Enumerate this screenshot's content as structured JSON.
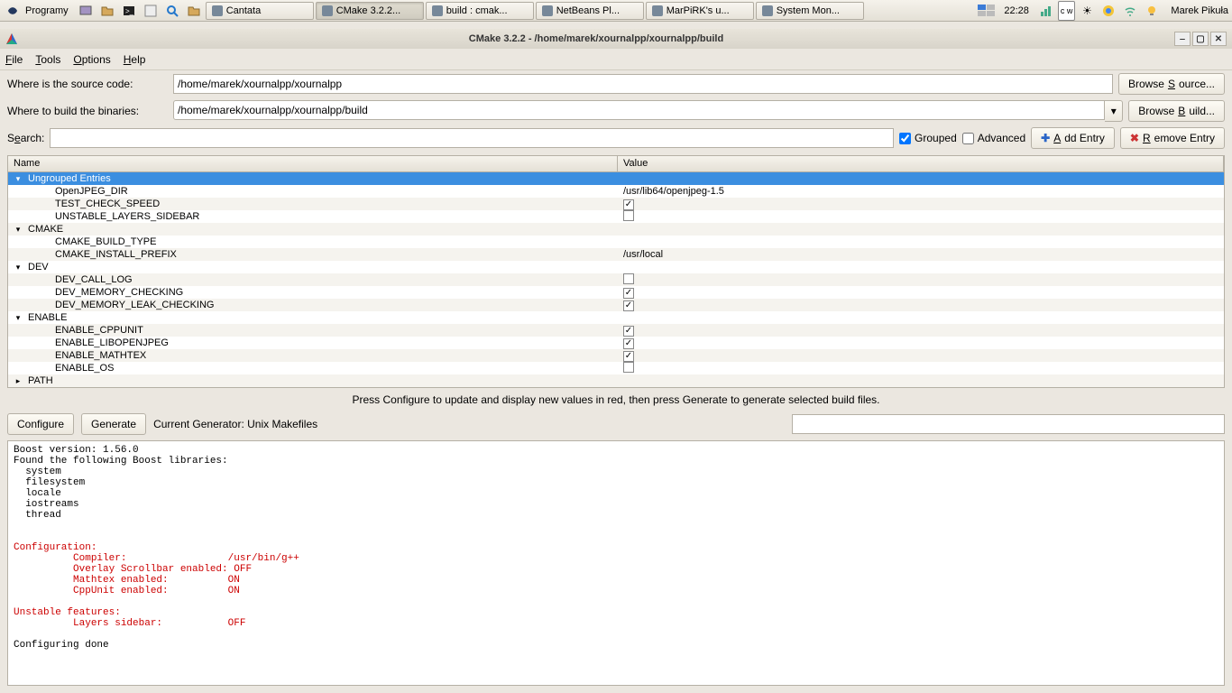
{
  "taskbar": {
    "programs_label": "Programy",
    "tasks": [
      {
        "label": "Cantata",
        "active": false
      },
      {
        "label": "CMake 3.2.2...",
        "active": true
      },
      {
        "label": "build : cmak...",
        "active": false
      },
      {
        "label": "NetBeans Pl...",
        "active": false
      },
      {
        "label": "MarPiRK's u...",
        "active": false
      },
      {
        "label": "System Mon...",
        "active": false
      }
    ],
    "clock": "22:28",
    "user": "Marek Pikuła"
  },
  "window": {
    "title": "CMake 3.2.2 - /home/marek/xournalpp/xournalpp/build"
  },
  "menu": {
    "file": "File",
    "tools": "Tools",
    "options": "Options",
    "help": "Help"
  },
  "form": {
    "source_label": "Where is the source code:",
    "source_value": "/home/marek/xournalpp/xournalpp",
    "browse_source": "Browse Source...",
    "build_label": "Where to build the binaries:",
    "build_value": "/home/marek/xournalpp/xournalpp/build",
    "browse_build": "Browse Build..."
  },
  "search": {
    "label": "Search:",
    "grouped_label": "Grouped",
    "grouped_checked": true,
    "advanced_label": "Advanced",
    "advanced_checked": false,
    "add_entry": "Add Entry",
    "remove_entry": "Remove Entry"
  },
  "tree": {
    "col_name": "Name",
    "col_value": "Value",
    "groups": [
      {
        "label": "Ungrouped Entries",
        "open": true,
        "selected": true,
        "items": [
          {
            "name": "OpenJPEG_DIR",
            "value": "/usr/lib64/openjpeg-1.5",
            "type": "text"
          },
          {
            "name": "TEST_CHECK_SPEED",
            "type": "check",
            "checked": true
          },
          {
            "name": "UNSTABLE_LAYERS_SIDEBAR",
            "type": "check",
            "checked": false
          }
        ]
      },
      {
        "label": "CMAKE",
        "open": true,
        "items": [
          {
            "name": "CMAKE_BUILD_TYPE",
            "type": "text",
            "value": ""
          },
          {
            "name": "CMAKE_INSTALL_PREFIX",
            "type": "text",
            "value": "/usr/local"
          }
        ]
      },
      {
        "label": "DEV",
        "open": true,
        "items": [
          {
            "name": "DEV_CALL_LOG",
            "type": "check",
            "checked": false
          },
          {
            "name": "DEV_MEMORY_CHECKING",
            "type": "check",
            "checked": true
          },
          {
            "name": "DEV_MEMORY_LEAK_CHECKING",
            "type": "check",
            "checked": true
          }
        ]
      },
      {
        "label": "ENABLE",
        "open": true,
        "items": [
          {
            "name": "ENABLE_CPPUNIT",
            "type": "check",
            "checked": true
          },
          {
            "name": "ENABLE_LIBOPENJPEG",
            "type": "check",
            "checked": true
          },
          {
            "name": "ENABLE_MATHTEX",
            "type": "check",
            "checked": true
          },
          {
            "name": "ENABLE_OS",
            "type": "check",
            "checked": false
          }
        ]
      },
      {
        "label": "PATH",
        "open": false,
        "items": []
      }
    ]
  },
  "hint": "Press Configure to update and display new values in red, then press Generate to generate selected build files.",
  "generate": {
    "configure": "Configure",
    "generate": "Generate",
    "current_label": "Current Generator: Unix Makefiles"
  },
  "log": {
    "black1": "Boost version: 1.56.0\nFound the following Boost libraries:\n  system\n  filesystem\n  locale\n  iostreams\n  thread\n\n",
    "red": "\nConfiguration:\n          Compiler:                 /usr/bin/g++\n          Overlay Scrollbar enabled: OFF\n          Mathtex enabled:          ON\n          CppUnit enabled:          ON\n\nUnstable features:\n          Layers sidebar:           OFF\n",
    "black2": "\nConfiguring done"
  }
}
